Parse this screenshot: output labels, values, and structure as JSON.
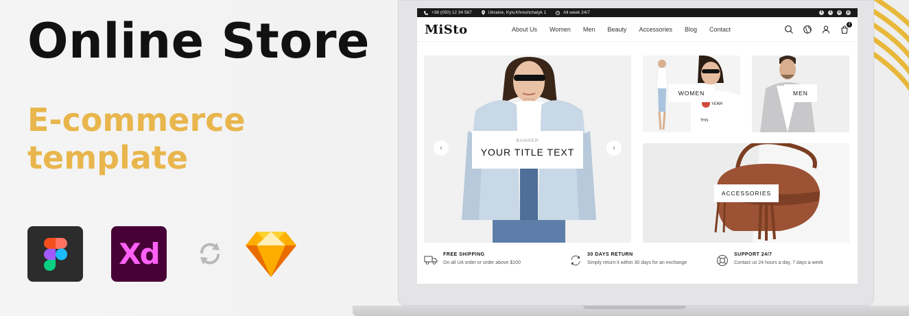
{
  "promo": {
    "title": "Online Store",
    "subtitle_line1": "E-commerce",
    "subtitle_line2": "template",
    "tool_icons": [
      "figma-icon",
      "adobe-xd-icon",
      "sync-icon",
      "sketch-icon"
    ],
    "xd_label": "Xd"
  },
  "colors": {
    "accent_gold": "#e8b64c",
    "dark": "#111111",
    "topbar": "#1a1a1a",
    "xd_bg": "#470137",
    "xd_fg": "#ff61f6"
  },
  "store": {
    "topbar": {
      "phone": "+38 (050) 12 34 567",
      "address": "Ukraine, Kyiv,Khreshchatyk 1",
      "hours": "All week 24/7",
      "socials": [
        "facebook-icon",
        "twitter-icon",
        "instagram-icon",
        "pinterest-icon"
      ]
    },
    "logo": "MiSto",
    "menu": [
      "About Us",
      "Women",
      "Men",
      "Beauty",
      "Accessories",
      "Blog",
      "Contact"
    ],
    "nav_icons": [
      "search-icon",
      "globe-icon",
      "user-icon",
      "cart-icon"
    ],
    "cart_count": "2",
    "hero": {
      "kicker": "BANNER",
      "title": "YOUR TITLE TEXT",
      "prev": "‹",
      "next": "›"
    },
    "categories": {
      "women": "WOMEN",
      "men": "MEN",
      "accessories": "ACCESSORIES"
    },
    "features": [
      {
        "icon": "truck-icon",
        "title": "FREE SHIPPING",
        "desc": "On all UA order or order above $100"
      },
      {
        "icon": "return-icon",
        "title": "30 DAYS RETURN",
        "desc": "Simply return it within 30 days for an exchange"
      },
      {
        "icon": "support-icon",
        "title": "SUPPORT 24/7",
        "desc": "Contact us 24 hours a day, 7 days a week"
      }
    ]
  }
}
